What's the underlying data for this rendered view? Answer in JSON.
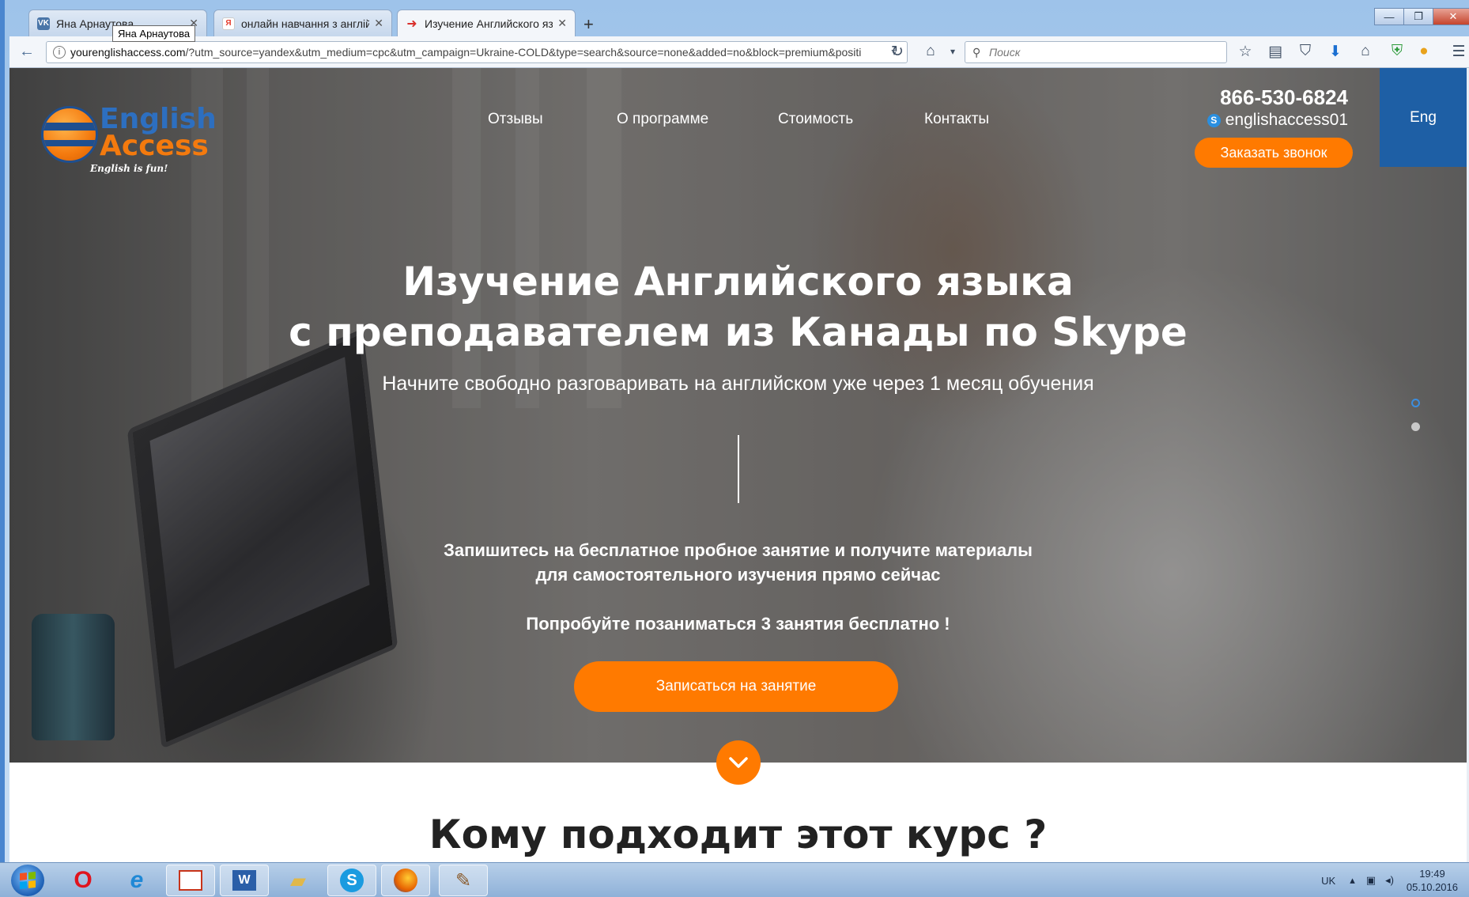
{
  "browser": {
    "tabs": [
      {
        "label": "Яна Арнаутова",
        "favicon": "vk-icon",
        "color": "#4a76a8",
        "glyph": "VK"
      },
      {
        "label": "онлайн навчання з англій...",
        "favicon": "yandex-icon",
        "color": "#e53b2c",
        "glyph": "Я"
      },
      {
        "label": "Изучение Английского яз...",
        "favicon": "site-icon",
        "color": "#d9302c",
        "glyph": "➜"
      }
    ],
    "tooltip": "Яна Арнаутова",
    "url_host": "yourenglishaccess.com",
    "url_rest": "/?utm_source=yandex&utm_medium=cpc&utm_campaign=Ukraine-COLD&type=search&source=none&added=no&block=premium&positi",
    "search_placeholder": "Поиск"
  },
  "site": {
    "logo": {
      "word1": "English",
      "word2": "Access",
      "tagline": "English is fun!"
    },
    "menu": [
      "Отзывы",
      "О программе",
      "Стоимость",
      "Контакты"
    ],
    "phone": "866-530-6824",
    "skype": "englishaccess01",
    "callback_label": "Заказать звонок",
    "lang_label": "Eng",
    "hero_title_line1": "Изучение Английского языка",
    "hero_title_line2": "с преподавателем из Канады по Skype",
    "hero_subtitle": "Начните свободно разговаривать на английском уже через 1 месяц обучения",
    "cta_line1": "Запишитесь на бесплатное пробное занятие и получите материалы",
    "cta_line2": "для самостоятельного изучения прямо сейчас",
    "free_text": "Попробуйте позаниматься 3 занятия бесплатно !",
    "signup_label": "Записаться на занятие",
    "section_title": "Кому подходит этот курс ?",
    "accent_color": "#ff7a00",
    "brand_blue": "#1e5fa5"
  },
  "taskbar": {
    "apps": [
      "opera-icon",
      "ie-icon",
      "pdf-icon",
      "word-icon",
      "explorer-icon",
      "skype-icon",
      "firefox-icon",
      "paint-icon"
    ],
    "lang": "UK",
    "time": "19:49",
    "date": "05.10.2016"
  }
}
